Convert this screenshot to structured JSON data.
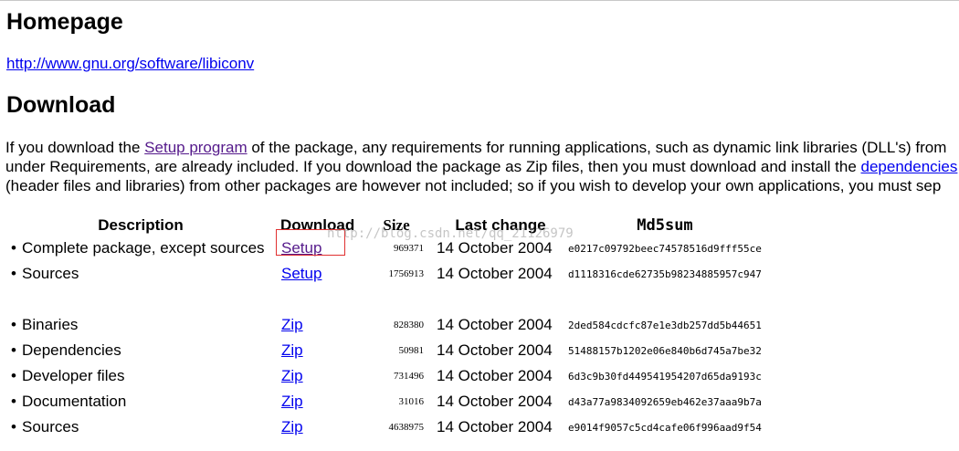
{
  "homepage": {
    "heading": "Homepage",
    "url": "http://www.gnu.org/software/libiconv"
  },
  "download": {
    "heading": "Download",
    "para": {
      "line1_pre": "If you download the ",
      "setup_link": "Setup program",
      "line1_post": " of the package, any requirements for running applications, such as dynamic link libraries (DLL's) from",
      "line2_pre": "under Requirements, are already included. If you download the package as Zip files, then you must download and install the ",
      "dependencies_link": "dependencies",
      "line3": "(header files and libraries) from other packages are however not included; so if you wish to develop your own applications, you must sep"
    }
  },
  "table": {
    "headers": {
      "description": "Description",
      "download": "Download",
      "size": "Size",
      "last_change": "Last change",
      "md5sum": "Md5sum"
    },
    "rows": [
      {
        "description": "Complete package, except sources",
        "link": "Setup",
        "size": "969371",
        "date": "14 October 2004",
        "md5": "e0217c09792beec74578516d9fff55ce"
      },
      {
        "description": "Sources",
        "link": "Setup",
        "size": "1756913",
        "date": "14 October 2004",
        "md5": "d1118316cde62735b98234885957c947"
      },
      {
        "description": "Binaries",
        "link": "Zip",
        "size": "828380",
        "date": "14 October 2004",
        "md5": "2ded584cdcfc87e1e3db257dd5b44651"
      },
      {
        "description": "Dependencies",
        "link": "Zip",
        "size": "50981",
        "date": "14 October 2004",
        "md5": "51488157b1202e06e840b6d745a7be32"
      },
      {
        "description": "Developer files",
        "link": "Zip",
        "size": "731496",
        "date": "14 October 2004",
        "md5": "6d3c9b30fd449541954207d65da9193c"
      },
      {
        "description": "Documentation",
        "link": "Zip",
        "size": "31016",
        "date": "14 October 2004",
        "md5": "d43a77a9834092659eb462e37aaa9b7a"
      },
      {
        "description": "Sources",
        "link": "Zip",
        "size": "4638975",
        "date": "14 October 2004",
        "md5": "e9014f9057c5cd4cafe06f996aad9f54"
      }
    ]
  },
  "watermark": "http://blog.csdn.net/qq_21126979",
  "colors": {
    "link": "#0000ee",
    "visited_link": "#551a8b",
    "highlight_box": "#e03030"
  }
}
